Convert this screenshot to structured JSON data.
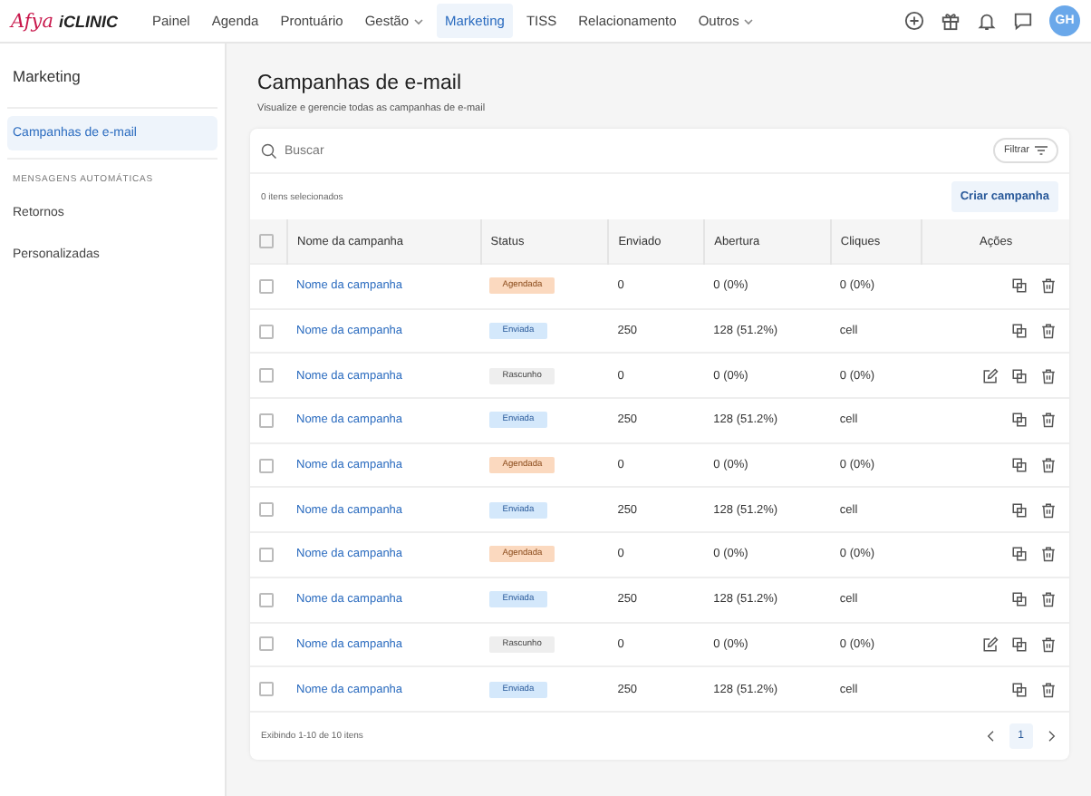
{
  "topbar": {
    "logo": {
      "brand": "Afya",
      "product": "iCLINIC"
    },
    "nav": [
      {
        "label": "Painel",
        "selected": false,
        "dropdown": false
      },
      {
        "label": "Agenda",
        "selected": false,
        "dropdown": false
      },
      {
        "label": "Prontuário",
        "selected": false,
        "dropdown": false
      },
      {
        "label": "Gestão",
        "selected": false,
        "dropdown": true
      },
      {
        "label": "Marketing",
        "selected": true,
        "dropdown": false
      },
      {
        "label": "TISS",
        "selected": false,
        "dropdown": false
      },
      {
        "label": "Relacionamento",
        "selected": false,
        "dropdown": false
      },
      {
        "label": "Outros",
        "selected": false,
        "dropdown": true
      }
    ],
    "avatar": "GH"
  },
  "sidebar": {
    "title": "Marketing",
    "items": [
      {
        "label": "Campanhas de e-mail",
        "selected": true
      }
    ],
    "section": "MENSAGENS AUTOMÁTICAS",
    "section_items": [
      {
        "label": "Retornos",
        "selected": false
      },
      {
        "label": "Personalizadas",
        "selected": false
      }
    ]
  },
  "page": {
    "title": "Campanhas de e-mail",
    "subtitle": "Visualize e gerencie todas as campanhas de e-mail"
  },
  "search": {
    "placeholder": "Buscar"
  },
  "filter_button": "Filtrar",
  "selection_count": "0 itens selecionados",
  "create_button": "Criar campanha",
  "table": {
    "select_all_checked": false,
    "columns": [
      "Nome da campanha",
      "Status",
      "Enviado",
      "Abertura",
      "Cliques",
      "Ações"
    ],
    "rows": [
      {
        "checked": false,
        "name": "Nome da campanha",
        "status": {
          "kind": "agendada",
          "label": "Agendada"
        },
        "sent": "0",
        "opens": "0 (0%)",
        "clicks": "0 (0%)",
        "editable": false
      },
      {
        "checked": false,
        "name": "Nome da campanha",
        "status": {
          "kind": "enviada",
          "label": "Enviada"
        },
        "sent": "250",
        "opens": "128 (51.2%)",
        "clicks": "cell",
        "editable": false
      },
      {
        "checked": false,
        "name": "Nome da campanha",
        "status": {
          "kind": "rascunho",
          "label": "Rascunho"
        },
        "sent": "0",
        "opens": "0 (0%)",
        "clicks": "0 (0%)",
        "editable": true
      },
      {
        "checked": false,
        "name": "Nome da campanha",
        "status": {
          "kind": "enviada",
          "label": "Enviada"
        },
        "sent": "250",
        "opens": "128 (51.2%)",
        "clicks": "cell",
        "editable": false
      },
      {
        "checked": false,
        "name": "Nome da campanha",
        "status": {
          "kind": "agendada",
          "label": "Agendada"
        },
        "sent": "0",
        "opens": "0 (0%)",
        "clicks": "0 (0%)",
        "editable": false
      },
      {
        "checked": false,
        "name": "Nome da campanha",
        "status": {
          "kind": "enviada",
          "label": "Enviada"
        },
        "sent": "250",
        "opens": "128 (51.2%)",
        "clicks": "cell",
        "editable": false
      },
      {
        "checked": false,
        "name": "Nome da campanha",
        "status": {
          "kind": "agendada",
          "label": "Agendada"
        },
        "sent": "0",
        "opens": "0 (0%)",
        "clicks": "0 (0%)",
        "editable": false
      },
      {
        "checked": false,
        "name": "Nome da campanha",
        "status": {
          "kind": "enviada",
          "label": "Enviada"
        },
        "sent": "250",
        "opens": "128 (51.2%)",
        "clicks": "cell",
        "editable": false
      },
      {
        "checked": false,
        "name": "Nome da campanha",
        "status": {
          "kind": "rascunho",
          "label": "Rascunho"
        },
        "sent": "0",
        "opens": "0 (0%)",
        "clicks": "0 (0%)",
        "editable": true
      },
      {
        "checked": false,
        "name": "Nome da campanha",
        "status": {
          "kind": "enviada",
          "label": "Enviada"
        },
        "sent": "250",
        "opens": "128 (51.2%)",
        "clicks": "cell",
        "editable": false
      }
    ]
  },
  "footer": {
    "summary": "Exibindo 1-10 de 10 itens",
    "pages": [
      {
        "label": "1",
        "selected": true
      }
    ]
  }
}
